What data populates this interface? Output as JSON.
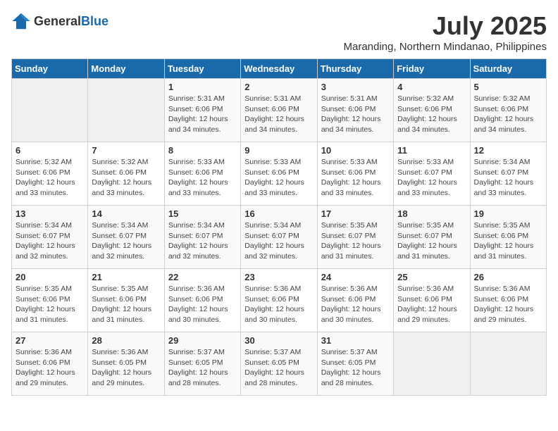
{
  "logo": {
    "general": "General",
    "blue": "Blue"
  },
  "title": {
    "month_year": "July 2025",
    "location": "Maranding, Northern Mindanao, Philippines"
  },
  "days_of_week": [
    "Sunday",
    "Monday",
    "Tuesday",
    "Wednesday",
    "Thursday",
    "Friday",
    "Saturday"
  ],
  "weeks": [
    [
      {
        "day": "",
        "info": ""
      },
      {
        "day": "",
        "info": ""
      },
      {
        "day": "1",
        "info": "Sunrise: 5:31 AM\nSunset: 6:06 PM\nDaylight: 12 hours and 34 minutes."
      },
      {
        "day": "2",
        "info": "Sunrise: 5:31 AM\nSunset: 6:06 PM\nDaylight: 12 hours and 34 minutes."
      },
      {
        "day": "3",
        "info": "Sunrise: 5:31 AM\nSunset: 6:06 PM\nDaylight: 12 hours and 34 minutes."
      },
      {
        "day": "4",
        "info": "Sunrise: 5:32 AM\nSunset: 6:06 PM\nDaylight: 12 hours and 34 minutes."
      },
      {
        "day": "5",
        "info": "Sunrise: 5:32 AM\nSunset: 6:06 PM\nDaylight: 12 hours and 34 minutes."
      }
    ],
    [
      {
        "day": "6",
        "info": "Sunrise: 5:32 AM\nSunset: 6:06 PM\nDaylight: 12 hours and 33 minutes."
      },
      {
        "day": "7",
        "info": "Sunrise: 5:32 AM\nSunset: 6:06 PM\nDaylight: 12 hours and 33 minutes."
      },
      {
        "day": "8",
        "info": "Sunrise: 5:33 AM\nSunset: 6:06 PM\nDaylight: 12 hours and 33 minutes."
      },
      {
        "day": "9",
        "info": "Sunrise: 5:33 AM\nSunset: 6:06 PM\nDaylight: 12 hours and 33 minutes."
      },
      {
        "day": "10",
        "info": "Sunrise: 5:33 AM\nSunset: 6:06 PM\nDaylight: 12 hours and 33 minutes."
      },
      {
        "day": "11",
        "info": "Sunrise: 5:33 AM\nSunset: 6:07 PM\nDaylight: 12 hours and 33 minutes."
      },
      {
        "day": "12",
        "info": "Sunrise: 5:34 AM\nSunset: 6:07 PM\nDaylight: 12 hours and 33 minutes."
      }
    ],
    [
      {
        "day": "13",
        "info": "Sunrise: 5:34 AM\nSunset: 6:07 PM\nDaylight: 12 hours and 32 minutes."
      },
      {
        "day": "14",
        "info": "Sunrise: 5:34 AM\nSunset: 6:07 PM\nDaylight: 12 hours and 32 minutes."
      },
      {
        "day": "15",
        "info": "Sunrise: 5:34 AM\nSunset: 6:07 PM\nDaylight: 12 hours and 32 minutes."
      },
      {
        "day": "16",
        "info": "Sunrise: 5:34 AM\nSunset: 6:07 PM\nDaylight: 12 hours and 32 minutes."
      },
      {
        "day": "17",
        "info": "Sunrise: 5:35 AM\nSunset: 6:07 PM\nDaylight: 12 hours and 31 minutes."
      },
      {
        "day": "18",
        "info": "Sunrise: 5:35 AM\nSunset: 6:07 PM\nDaylight: 12 hours and 31 minutes."
      },
      {
        "day": "19",
        "info": "Sunrise: 5:35 AM\nSunset: 6:06 PM\nDaylight: 12 hours and 31 minutes."
      }
    ],
    [
      {
        "day": "20",
        "info": "Sunrise: 5:35 AM\nSunset: 6:06 PM\nDaylight: 12 hours and 31 minutes."
      },
      {
        "day": "21",
        "info": "Sunrise: 5:35 AM\nSunset: 6:06 PM\nDaylight: 12 hours and 31 minutes."
      },
      {
        "day": "22",
        "info": "Sunrise: 5:36 AM\nSunset: 6:06 PM\nDaylight: 12 hours and 30 minutes."
      },
      {
        "day": "23",
        "info": "Sunrise: 5:36 AM\nSunset: 6:06 PM\nDaylight: 12 hours and 30 minutes."
      },
      {
        "day": "24",
        "info": "Sunrise: 5:36 AM\nSunset: 6:06 PM\nDaylight: 12 hours and 30 minutes."
      },
      {
        "day": "25",
        "info": "Sunrise: 5:36 AM\nSunset: 6:06 PM\nDaylight: 12 hours and 29 minutes."
      },
      {
        "day": "26",
        "info": "Sunrise: 5:36 AM\nSunset: 6:06 PM\nDaylight: 12 hours and 29 minutes."
      }
    ],
    [
      {
        "day": "27",
        "info": "Sunrise: 5:36 AM\nSunset: 6:06 PM\nDaylight: 12 hours and 29 minutes."
      },
      {
        "day": "28",
        "info": "Sunrise: 5:36 AM\nSunset: 6:05 PM\nDaylight: 12 hours and 29 minutes."
      },
      {
        "day": "29",
        "info": "Sunrise: 5:37 AM\nSunset: 6:05 PM\nDaylight: 12 hours and 28 minutes."
      },
      {
        "day": "30",
        "info": "Sunrise: 5:37 AM\nSunset: 6:05 PM\nDaylight: 12 hours and 28 minutes."
      },
      {
        "day": "31",
        "info": "Sunrise: 5:37 AM\nSunset: 6:05 PM\nDaylight: 12 hours and 28 minutes."
      },
      {
        "day": "",
        "info": ""
      },
      {
        "day": "",
        "info": ""
      }
    ]
  ]
}
